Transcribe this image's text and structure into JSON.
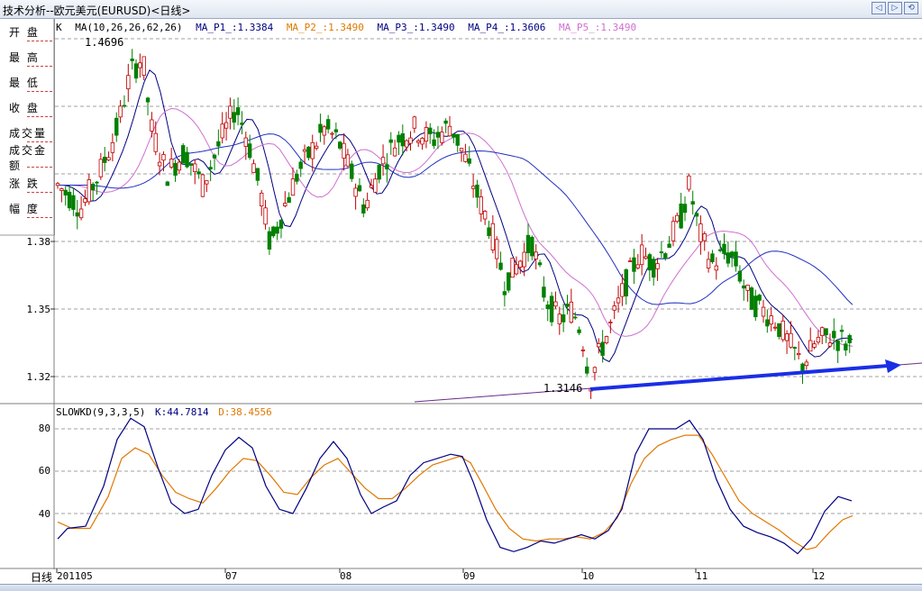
{
  "window": {
    "title": "技术分析--欧元美元(EURUSD)<日线>",
    "controls": [
      "back-icon",
      "forward-icon",
      "refresh-icon"
    ]
  },
  "sidebar": {
    "items": [
      {
        "label": "开  盘"
      },
      {
        "label": "最  高"
      },
      {
        "label": "最  低"
      },
      {
        "label": "收  盘"
      },
      {
        "label": "成交量"
      },
      {
        "label": "成交金额"
      },
      {
        "label": "涨  跌"
      },
      {
        "label": "幅  度"
      }
    ]
  },
  "main_legend": {
    "prefix": "K",
    "ma_params": "MA(10,26,26,62,26)",
    "items": [
      {
        "text": "MA_P1_:1.3384",
        "color": "#000080"
      },
      {
        "text": "MA_P2_:1.3490",
        "color": "#e07800"
      },
      {
        "text": "MA_P3_:1.3490",
        "color": "#000080"
      },
      {
        "text": "MA_P4_:1.3606",
        "color": "#000080"
      },
      {
        "text": "MA_P5_:1.3490",
        "color": "#d070d0"
      }
    ]
  },
  "annotations": {
    "high_label": "1.4696",
    "low_label": "1.3146"
  },
  "price_axis": {
    "ticks": [
      "1.38",
      "1.35",
      "1.32"
    ]
  },
  "kd_legend": {
    "name": "SLOWKD(9,3,3,5)",
    "k_text": "K:44.7814",
    "d_text": "D:38.4556",
    "k_color": "#000080",
    "d_color": "#e07800"
  },
  "kd_axis": {
    "ticks": [
      "80",
      "60",
      "40"
    ]
  },
  "x_axis": {
    "period_label": "日线",
    "labels": [
      "201105",
      "07",
      "08",
      "09",
      "10",
      "11",
      "12"
    ]
  },
  "colors": {
    "up_candle": "#c00000",
    "down_candle": "#008000",
    "trend_arrow": "#1a2ee6",
    "grid": "#a0a0a0"
  },
  "chart_data": [
    {
      "type": "candlestick",
      "title": "",
      "ylim": [
        1.3,
        1.475
      ],
      "y_ticks": [
        1.38,
        1.35,
        1.32
      ],
      "annotations": [
        {
          "text": "1.4696",
          "value": 1.4696
        },
        {
          "text": "1.3146",
          "value": 1.3146
        }
      ],
      "series": [
        {
          "name": "MA_P1_",
          "last": 1.3384
        },
        {
          "name": "MA_P2_",
          "last": 1.349
        },
        {
          "name": "MA_P3_",
          "last": 1.349
        },
        {
          "name": "MA_P4_",
          "last": 1.3606
        },
        {
          "name": "MA_P5_",
          "last": 1.349
        }
      ]
    },
    {
      "type": "line",
      "title": "",
      "ylim": [
        27,
        90
      ],
      "y_ticks": [
        80,
        60,
        40
      ],
      "series": [
        {
          "name": "K",
          "last": 44.7814
        },
        {
          "name": "D",
          "last": 38.4556
        }
      ]
    }
  ]
}
